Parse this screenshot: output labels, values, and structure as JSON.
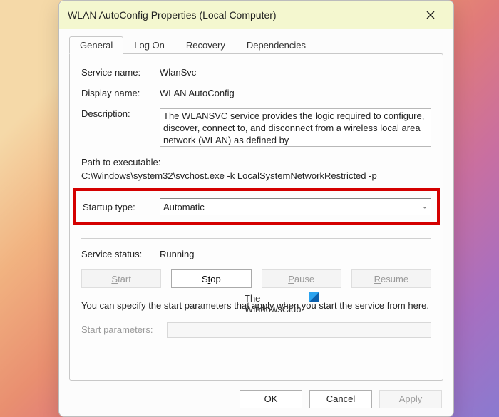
{
  "title": "WLAN AutoConfig Properties (Local Computer)",
  "tabs": [
    "General",
    "Log On",
    "Recovery",
    "Dependencies"
  ],
  "labels": {
    "service_name": "Service name:",
    "display_name": "Display name:",
    "description": "Description:",
    "path": "Path to executable:",
    "startup_type": "Startup type:",
    "service_status": "Service status:",
    "start_params": "Start parameters:"
  },
  "values": {
    "service_name": "WlanSvc",
    "display_name": "WLAN AutoConfig",
    "description": "The WLANSVC service provides the logic required to configure, discover, connect to, and disconnect from a wireless local area network (WLAN) as defined by",
    "path": "C:\\Windows\\system32\\svchost.exe -k LocalSystemNetworkRestricted -p",
    "startup_type": "Automatic",
    "service_status": "Running"
  },
  "service_buttons": {
    "start": "Start",
    "stop": "Stop",
    "pause": "Pause",
    "resume": "Resume"
  },
  "note": "You can specify the start parameters that apply when you start the service from here.",
  "dialog_buttons": {
    "ok": "OK",
    "cancel": "Cancel",
    "apply": "Apply"
  },
  "watermark": {
    "line1": "The",
    "line2": "WindowsClub"
  }
}
